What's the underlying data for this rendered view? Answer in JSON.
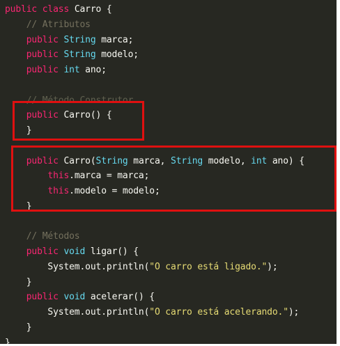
{
  "colors": {
    "background": "#272822",
    "keyword": "#f92672",
    "type": "#66d9ef",
    "plain": "#f8f8f2",
    "string": "#e6db74",
    "comment": "#75715e",
    "highlight_box": "#e01010"
  },
  "code": {
    "lines": [
      {
        "indent": "",
        "tokens": [
          {
            "t": "public",
            "c": "kw"
          },
          {
            "t": " ",
            "c": "pl"
          },
          {
            "t": "class",
            "c": "kw"
          },
          {
            "t": " Carro {",
            "c": "pl"
          }
        ]
      },
      {
        "indent": "    ",
        "tokens": [
          {
            "t": "// Atributos",
            "c": "cm"
          }
        ]
      },
      {
        "indent": "    ",
        "tokens": [
          {
            "t": "public",
            "c": "kw"
          },
          {
            "t": " ",
            "c": "pl"
          },
          {
            "t": "String",
            "c": "ty"
          },
          {
            "t": " marca;",
            "c": "pl"
          }
        ]
      },
      {
        "indent": "    ",
        "tokens": [
          {
            "t": "public",
            "c": "kw"
          },
          {
            "t": " ",
            "c": "pl"
          },
          {
            "t": "String",
            "c": "ty"
          },
          {
            "t": " modelo;",
            "c": "pl"
          }
        ]
      },
      {
        "indent": "    ",
        "tokens": [
          {
            "t": "public",
            "c": "kw"
          },
          {
            "t": " ",
            "c": "pl"
          },
          {
            "t": "int",
            "c": "ty"
          },
          {
            "t": " ano;",
            "c": "pl"
          }
        ]
      },
      {
        "indent": "",
        "tokens": []
      },
      {
        "indent": "    ",
        "tokens": [
          {
            "t": "// Método Construtor",
            "c": "dim"
          }
        ]
      },
      {
        "indent": "    ",
        "tokens": [
          {
            "t": "public",
            "c": "kw"
          },
          {
            "t": " Carro() {",
            "c": "pl"
          }
        ]
      },
      {
        "indent": "    ",
        "tokens": [
          {
            "t": "}",
            "c": "pl"
          }
        ]
      },
      {
        "indent": "",
        "tokens": []
      },
      {
        "indent": "    ",
        "tokens": [
          {
            "t": "public",
            "c": "kw"
          },
          {
            "t": " Carro(",
            "c": "pl"
          },
          {
            "t": "String",
            "c": "ty"
          },
          {
            "t": " marca, ",
            "c": "pl"
          },
          {
            "t": "String",
            "c": "ty"
          },
          {
            "t": " modelo, ",
            "c": "pl"
          },
          {
            "t": "int",
            "c": "ty"
          },
          {
            "t": " ano) {",
            "c": "pl"
          }
        ]
      },
      {
        "indent": "        ",
        "tokens": [
          {
            "t": "this",
            "c": "kw"
          },
          {
            "t": ".marca = marca;",
            "c": "pl"
          }
        ]
      },
      {
        "indent": "        ",
        "tokens": [
          {
            "t": "this",
            "c": "kw"
          },
          {
            "t": ".modelo = modelo;",
            "c": "pl"
          }
        ]
      },
      {
        "indent": "    ",
        "tokens": [
          {
            "t": "}",
            "c": "pl"
          }
        ]
      },
      {
        "indent": "",
        "tokens": []
      },
      {
        "indent": "    ",
        "tokens": [
          {
            "t": "// Métodos",
            "c": "cm"
          }
        ]
      },
      {
        "indent": "    ",
        "tokens": [
          {
            "t": "public",
            "c": "kw"
          },
          {
            "t": " ",
            "c": "pl"
          },
          {
            "t": "void",
            "c": "ty"
          },
          {
            "t": " ligar() {",
            "c": "pl"
          }
        ]
      },
      {
        "indent": "        ",
        "tokens": [
          {
            "t": "System.out.println(",
            "c": "pl"
          },
          {
            "t": "\"O carro está ligado.\"",
            "c": "st"
          },
          {
            "t": ");",
            "c": "pl"
          }
        ]
      },
      {
        "indent": "    ",
        "tokens": [
          {
            "t": "}",
            "c": "pl"
          }
        ]
      },
      {
        "indent": "    ",
        "tokens": [
          {
            "t": "public",
            "c": "kw"
          },
          {
            "t": " ",
            "c": "pl"
          },
          {
            "t": "void",
            "c": "ty"
          },
          {
            "t": " acelerar() {",
            "c": "pl"
          }
        ]
      },
      {
        "indent": "        ",
        "tokens": [
          {
            "t": "System.out.println(",
            "c": "pl"
          },
          {
            "t": "\"O carro está acelerando.\"",
            "c": "st"
          },
          {
            "t": ");",
            "c": "pl"
          }
        ]
      },
      {
        "indent": "    ",
        "tokens": [
          {
            "t": "}",
            "c": "pl"
          }
        ]
      },
      {
        "indent": "",
        "tokens": [
          {
            "t": "}",
            "c": "pl"
          }
        ]
      }
    ]
  }
}
